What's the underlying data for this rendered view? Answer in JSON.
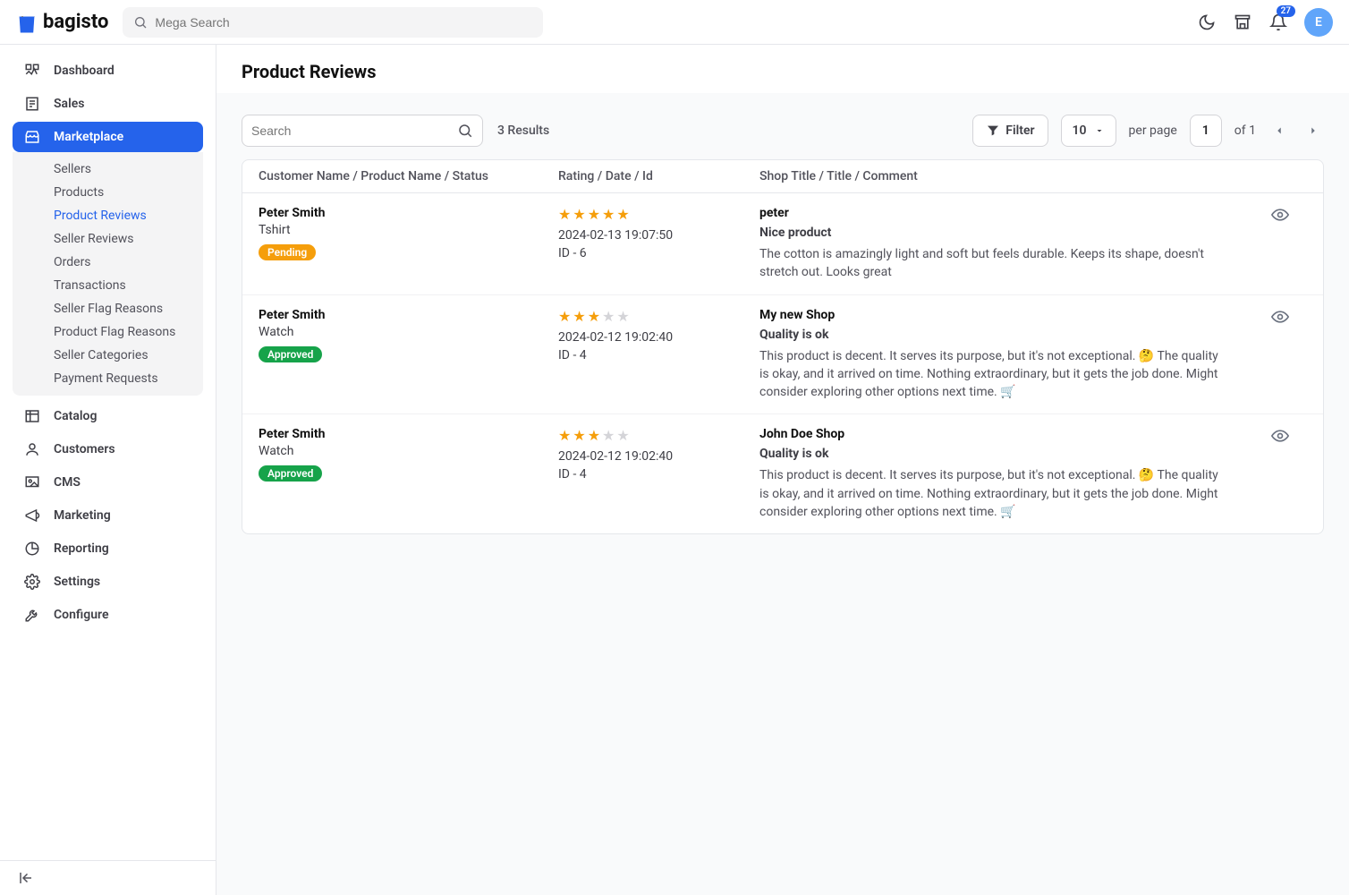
{
  "header": {
    "brand": "bagisto",
    "mega_search_placeholder": "Mega Search",
    "notification_count": "27",
    "avatar_initial": "E"
  },
  "sidebar": {
    "items": [
      {
        "label": "Dashboard",
        "icon": "dashboard"
      },
      {
        "label": "Sales",
        "icon": "sales"
      },
      {
        "label": "Marketplace",
        "icon": "marketplace",
        "active": true,
        "children": [
          {
            "label": "Sellers"
          },
          {
            "label": "Products"
          },
          {
            "label": "Product Reviews",
            "active": true
          },
          {
            "label": "Seller Reviews"
          },
          {
            "label": "Orders"
          },
          {
            "label": "Transactions"
          },
          {
            "label": "Seller Flag Reasons"
          },
          {
            "label": "Product Flag Reasons"
          },
          {
            "label": "Seller Categories"
          },
          {
            "label": "Payment Requests"
          }
        ]
      },
      {
        "label": "Catalog",
        "icon": "catalog"
      },
      {
        "label": "Customers",
        "icon": "customers"
      },
      {
        "label": "CMS",
        "icon": "cms"
      },
      {
        "label": "Marketing",
        "icon": "marketing"
      },
      {
        "label": "Reporting",
        "icon": "reporting"
      },
      {
        "label": "Settings",
        "icon": "settings"
      },
      {
        "label": "Configure",
        "icon": "configure"
      }
    ]
  },
  "page": {
    "title": "Product Reviews",
    "search_placeholder": "Search",
    "results_label": "3 Results",
    "filter_label": "Filter",
    "per_page_value": "10",
    "per_page_label": "per page",
    "current_page": "1",
    "of_label": "of 1",
    "columns": {
      "a": "Customer Name / Product Name / Status",
      "b": "Rating / Date / Id",
      "c": "Shop Title / Title / Comment"
    },
    "rows": [
      {
        "customer": "Peter Smith",
        "product": "Tshirt",
        "status": "Pending",
        "status_class": "status-pending",
        "rating": 5,
        "date": "2024-02-13 19:07:50",
        "id": "ID - 6",
        "shop": "peter",
        "title": "Nice product",
        "comment": "The cotton is amazingly light and soft but feels durable. Keeps its shape, doesn't stretch out. Looks great"
      },
      {
        "customer": "Peter Smith",
        "product": "Watch",
        "status": "Approved",
        "status_class": "status-approved",
        "rating": 3,
        "date": "2024-02-12 19:02:40",
        "id": "ID - 4",
        "shop": "My new Shop",
        "title": "Quality is ok",
        "comment": "This product is decent. It serves its purpose, but it's not exceptional. 🤔 The quality is okay, and it arrived on time. Nothing extraordinary, but it gets the job done. Might consider exploring other options next time. 🛒"
      },
      {
        "customer": "Peter Smith",
        "product": "Watch",
        "status": "Approved",
        "status_class": "status-approved",
        "rating": 3,
        "date": "2024-02-12 19:02:40",
        "id": "ID - 4",
        "shop": "John Doe Shop",
        "title": "Quality is ok",
        "comment": "This product is decent. It serves its purpose, but it's not exceptional. 🤔 The quality is okay, and it arrived on time. Nothing extraordinary, but it gets the job done. Might consider exploring other options next time. 🛒"
      }
    ]
  }
}
